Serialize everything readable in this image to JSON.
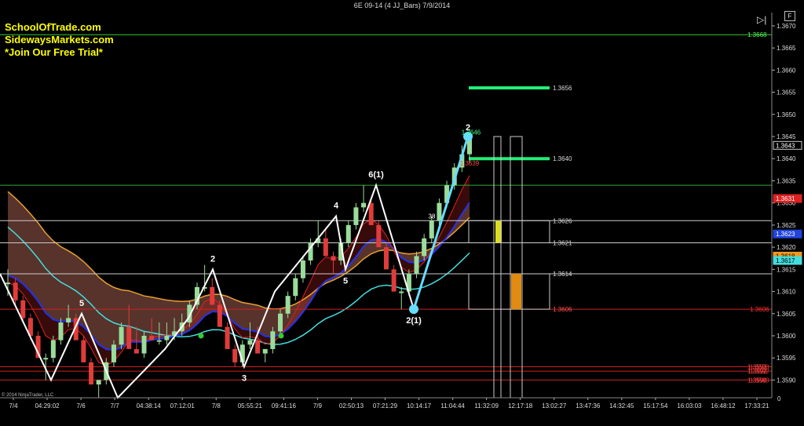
{
  "window": {
    "title": "6E 09-14 (4 JJ_Bars)  7/9/2014"
  },
  "branding": {
    "line1": "SchoolOfTrade.com",
    "line2": "SidewaysMarkets.com",
    "line3": "*Join Our Free Trial*"
  },
  "copyright": "© 2014 NinjaTrader, LLC",
  "controls": {
    "corner_button": "F",
    "play_icon": "play-end-icon"
  },
  "colors": {
    "background": "#000000",
    "bull_bar": "#9bdc9b",
    "bear_bar": "#e03c3c",
    "zigzag": "#ffffff",
    "projection": "#66ddff",
    "target": "#22ee77",
    "band_fill": "#c07060",
    "lower_band_fill": "#a02020"
  },
  "chart_data": {
    "type": "line",
    "instrument": "6E 09-14",
    "bar_type": "4 JJ_Bars",
    "date": "7/9/2014",
    "ylim": [
      1.3586,
      1.3673
    ],
    "y_ticks": [
      "1.3670",
      "1.3665",
      "1.3660",
      "1.3655",
      "1.3650",
      "1.3645",
      "1.3640",
      "1.3635",
      "1.3630",
      "1.3625",
      "1.3620",
      "1.3615",
      "1.3610",
      "1.3605",
      "1.3600",
      "1.3595",
      "1.3590"
    ],
    "x_ticks": [
      "7/4",
      "04:29:02",
      "7/6",
      "7/7",
      "04:38:14",
      "07:12:01",
      "7/8",
      "05:55:21",
      "09:41:16",
      "7/9",
      "02:50:13",
      "07:21:29",
      "10:14:17",
      "11:04:44",
      "11:32:09",
      "12:17:18",
      "13:02:27",
      "13:47:36",
      "14:32:45",
      "15:17:54",
      "16:03:03",
      "16:48:12",
      "17:33:21"
    ],
    "x_extra_label": "0",
    "bars": [
      [
        1.3612,
        1.3615,
        1.3609
      ],
      [
        1.3612,
        1.3613,
        1.3607
      ],
      [
        1.3608,
        1.3609,
        1.3603
      ],
      [
        1.3604,
        1.3605,
        1.3599
      ],
      [
        1.36,
        1.3601,
        1.3595
      ],
      [
        1.3595,
        1.3596,
        1.359
      ],
      [
        1.3595,
        1.36,
        1.3594
      ],
      [
        1.3599,
        1.3604,
        1.3598
      ],
      [
        1.3603,
        1.3607,
        1.3602
      ],
      [
        1.3604,
        1.3605,
        1.3599
      ],
      [
        1.3599,
        1.36,
        1.3594
      ],
      [
        1.3594,
        1.3595,
        1.3589
      ],
      [
        1.3589,
        1.359,
        1.3586
      ],
      [
        1.359,
        1.3595,
        1.3589
      ],
      [
        1.3594,
        1.3599,
        1.3593
      ],
      [
        1.3598,
        1.3603,
        1.3597
      ],
      [
        1.3602,
        1.3607,
        1.3601
      ],
      [
        1.3597,
        1.3602,
        1.3596
      ],
      [
        1.3596,
        1.3601,
        1.3595
      ],
      [
        1.36,
        1.3604,
        1.3599
      ],
      [
        1.3599,
        1.3603,
        1.3598
      ],
      [
        1.3599,
        1.3603,
        1.3598
      ],
      [
        1.36,
        1.3604,
        1.3599
      ],
      [
        1.3601,
        1.3605,
        1.36
      ],
      [
        1.3603,
        1.3608,
        1.3602
      ],
      [
        1.3607,
        1.3612,
        1.3606
      ],
      [
        1.3611,
        1.3616,
        1.361
      ],
      [
        1.3611,
        1.3613,
        1.3607
      ],
      [
        1.3607,
        1.3608,
        1.3602
      ],
      [
        1.3602,
        1.3603,
        1.3597
      ],
      [
        1.3597,
        1.3598,
        1.3593
      ],
      [
        1.3594,
        1.3599,
        1.3593
      ],
      [
        1.3598,
        1.3603,
        1.3597
      ],
      [
        1.3599,
        1.3602,
        1.3596
      ],
      [
        1.3596,
        1.3597,
        1.3594
      ],
      [
        1.3597,
        1.3602,
        1.3596
      ],
      [
        1.3601,
        1.3606,
        1.36
      ],
      [
        1.3605,
        1.361,
        1.3604
      ],
      [
        1.3609,
        1.3614,
        1.3608
      ],
      [
        1.3613,
        1.3618,
        1.3612
      ],
      [
        1.3617,
        1.3622,
        1.3616
      ],
      [
        1.3621,
        1.3626,
        1.362
      ],
      [
        1.3622,
        1.3624,
        1.3618
      ],
      [
        1.3618,
        1.3619,
        1.3614
      ],
      [
        1.3617,
        1.3622,
        1.3616
      ],
      [
        1.3621,
        1.3626,
        1.362
      ],
      [
        1.3625,
        1.363,
        1.3624
      ],
      [
        1.3629,
        1.3634,
        1.3628
      ],
      [
        1.363,
        1.3631,
        1.3625
      ],
      [
        1.3625,
        1.3626,
        1.362
      ],
      [
        1.362,
        1.3621,
        1.3615
      ],
      [
        1.3615,
        1.3616,
        1.361
      ],
      [
        1.361,
        1.3611,
        1.3606
      ],
      [
        1.361,
        1.3615,
        1.3609
      ],
      [
        1.3614,
        1.3619,
        1.3613
      ],
      [
        1.3618,
        1.3623,
        1.3617
      ],
      [
        1.3622,
        1.3627,
        1.3621
      ],
      [
        1.3626,
        1.3631,
        1.3625
      ],
      [
        1.363,
        1.3635,
        1.3629
      ],
      [
        1.3634,
        1.3639,
        1.3633
      ],
      [
        1.3638,
        1.3643,
        1.3637
      ],
      [
        1.3641,
        1.3645,
        1.3639
      ]
    ],
    "zigzag": [
      [
        1.3614,
        ""
      ],
      [
        1.359,
        ""
      ],
      [
        1.3605,
        "5"
      ],
      [
        1.3586,
        ""
      ],
      [
        1.3597,
        ""
      ],
      [
        1.3604,
        ""
      ],
      [
        1.3615,
        "2"
      ],
      [
        1.3593,
        "3"
      ],
      [
        1.361,
        ""
      ],
      [
        1.3627,
        "4"
      ],
      [
        1.3615,
        "5"
      ],
      [
        1.3634,
        "6(1)"
      ],
      [
        1.3606,
        "2(1)"
      ]
    ],
    "projection_line": {
      "from": 1.3606,
      "to": 1.3645,
      "label": "2"
    },
    "horizontal_levels": [
      {
        "value": 1.3668,
        "label": "1.3668",
        "color": "#33cc33"
      },
      {
        "value": 1.3656,
        "label": "1.3656",
        "color": "#22ee77"
      },
      {
        "value": 1.364,
        "label": "1.3640",
        "color": "#22ee77"
      },
      {
        "value": 1.3634,
        "label": "",
        "color": "#33aa33"
      },
      {
        "value": 1.3626,
        "label": "1.3626",
        "color": "#cccccc"
      },
      {
        "value": 1.3621,
        "label": "1.3621",
        "color": "#cccccc"
      },
      {
        "value": 1.3614,
        "label": "1.3614",
        "color": "#cccccc"
      },
      {
        "value": 1.3606,
        "label": "1.3606",
        "color": "#cc2222"
      },
      {
        "value": 1.3593,
        "label": "1.3593",
        "color": "#cc2222"
      },
      {
        "value": 1.3592,
        "label": "1.3592",
        "color": "#cc2222"
      },
      {
        "value": 1.359,
        "label": "1.3590",
        "color": "#cc2222"
      }
    ],
    "annotations": [
      {
        "text": "1.3646",
        "value": 1.3646,
        "color": "#44ff88"
      },
      {
        "text": "1.3639",
        "value": 1.3639,
        "color": "#ff4444"
      },
      {
        "text": "38",
        "value": 1.3627,
        "color": "#ffffff"
      }
    ],
    "price_tags": [
      {
        "text": "1.3643",
        "value": 1.3643,
        "bg": "#000000",
        "fg": "#ffffff"
      },
      {
        "text": "1.3631",
        "value": 1.3631,
        "bg": "#dd2222",
        "fg": "#ffffff"
      },
      {
        "text": "1.3623",
        "value": 1.3623,
        "bg": "#2244dd",
        "fg": "#ffffff"
      },
      {
        "text": "1.3618",
        "value": 1.3618,
        "bg": "#ee9922",
        "fg": "#000000"
      },
      {
        "text": "1.3617",
        "value": 1.3617,
        "bg": "#44dddd",
        "fg": "#000000"
      },
      {
        "text": "1.3606",
        "value": 1.3606,
        "bg": "",
        "fg": "#ff3333"
      },
      {
        "text": "1.3593",
        "value": 1.3593,
        "bg": "",
        "fg": "#ff3333"
      },
      {
        "text": "1.3592",
        "value": 1.3592,
        "bg": "",
        "fg": "#ff3333"
      },
      {
        "text": "1.3590",
        "value": 1.359,
        "bg": "",
        "fg": "#ff3333"
      }
    ]
  }
}
